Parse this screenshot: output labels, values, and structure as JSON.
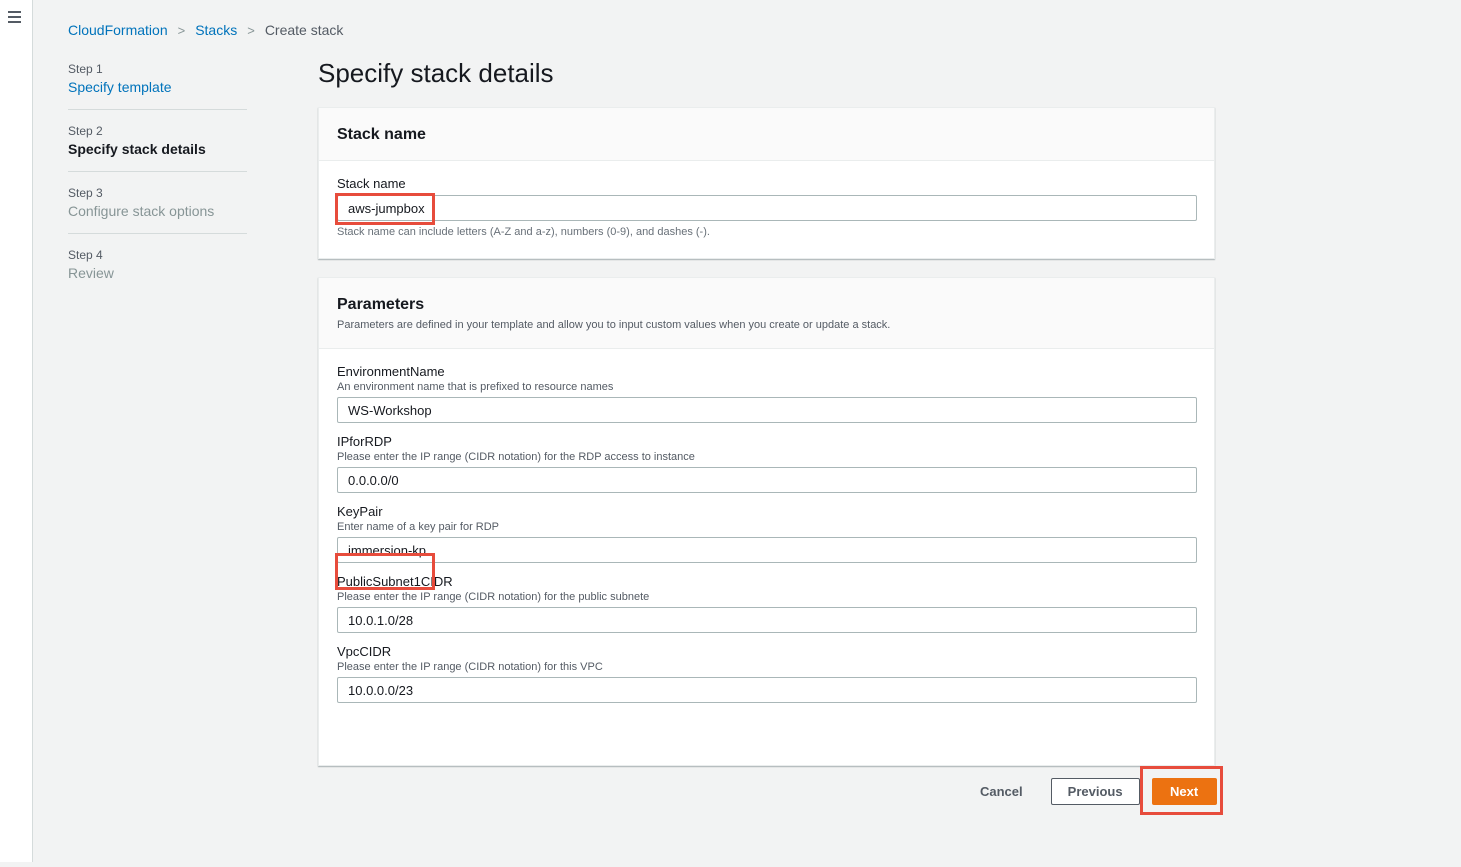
{
  "breadcrumb": {
    "items": [
      "CloudFormation",
      "Stacks"
    ],
    "current": "Create stack"
  },
  "steps": [
    {
      "num": "Step 1",
      "title": "Specify template",
      "state": "link"
    },
    {
      "num": "Step 2",
      "title": "Specify stack details",
      "state": "active"
    },
    {
      "num": "Step 3",
      "title": "Configure stack options",
      "state": "disabled"
    },
    {
      "num": "Step 4",
      "title": "Review",
      "state": "disabled"
    }
  ],
  "page_title": "Specify stack details",
  "stack_name_panel": {
    "header": "Stack name",
    "label": "Stack name",
    "value": "aws-jumpbox",
    "constraint": "Stack name can include letters (A-Z and a-z), numbers (0-9), and dashes (-)."
  },
  "parameters_panel": {
    "header": "Parameters",
    "description": "Parameters are defined in your template and allow you to input custom values when you create or update a stack.",
    "fields": [
      {
        "label": "EnvironmentName",
        "hint": "An environment name that is prefixed to resource names",
        "value": "WS-Workshop"
      },
      {
        "label": "IPforRDP",
        "hint": "Please enter the IP range (CIDR notation) for the RDP access to instance",
        "value": "0.0.0.0/0"
      },
      {
        "label": "KeyPair",
        "hint": "Enter name of a key pair for RDP",
        "value": "immersion-kp"
      },
      {
        "label": "PublicSubnet1CIDR",
        "hint": "Please enter the IP range (CIDR notation) for the public subnete",
        "value": "10.0.1.0/28"
      },
      {
        "label": "VpcCIDR",
        "hint": "Please enter the IP range (CIDR notation) for this VPC",
        "value": "10.0.0.0/23"
      }
    ]
  },
  "actions": {
    "cancel": "Cancel",
    "previous": "Previous",
    "next": "Next"
  },
  "colors": {
    "link": "#0073bb",
    "primary_button": "#ec7211",
    "highlight_box": "#e74c3c"
  }
}
